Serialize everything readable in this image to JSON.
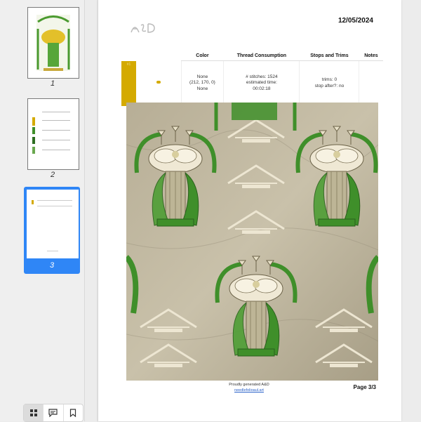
{
  "sidebar": {
    "thumbnails": [
      {
        "number": "1"
      },
      {
        "number": "2"
      },
      {
        "number": "3"
      }
    ],
    "toolbar": {
      "grid": "grid-icon",
      "comments": "comment-icon",
      "bookmark": "bookmark-icon"
    }
  },
  "page": {
    "date": "12/05/2024",
    "table": {
      "headers": [
        "Color",
        "Thread Consumption",
        "Stops and Trims",
        "Notes"
      ],
      "row": {
        "index": "#1",
        "color_name": "None",
        "color_rgb": "(212, 170, 0)",
        "color_extra": "None",
        "stitches": "# stitches: 1524",
        "time_label": "estimated time:",
        "time_value": "00:02:18",
        "trims": "trims: 0",
        "stop_after": "stop after?: no",
        "notes": ""
      }
    },
    "footer": {
      "generated": "Proudly generated A&D",
      "link": "needlefolioaul.art"
    },
    "page_number": "Page 3/3"
  },
  "colors": {
    "accent": "#2f86f6",
    "thread": "#d4aa00",
    "leaf": "#3f8f2a"
  }
}
